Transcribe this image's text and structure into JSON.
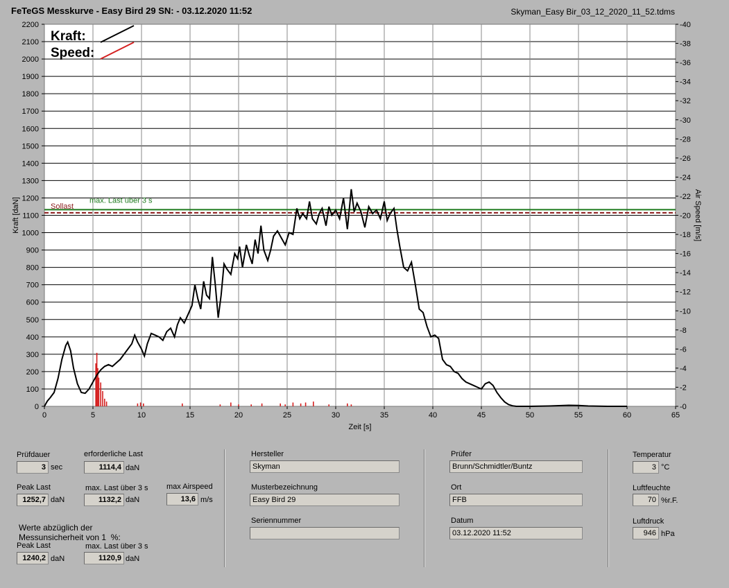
{
  "header": {
    "title": "FeTeGS Messkurve - Easy Bird 29  SN:  - 03.12.2020 11:52",
    "filename": "Skyman_Easy Bir_03_12_2020_11_52.tdms"
  },
  "chart_data": {
    "type": "line",
    "xlabel": "Zeit [s]",
    "ylabel": "Kraft [daN]",
    "y2label": "Air Speed [m/s]",
    "xlim": [
      0,
      65
    ],
    "ylim": [
      0,
      2200
    ],
    "y2lim": [
      0,
      40
    ],
    "xticks": [
      0,
      5,
      10,
      15,
      20,
      25,
      30,
      35,
      40,
      45,
      50,
      55,
      60,
      65
    ],
    "yticks": [
      0,
      100,
      200,
      300,
      400,
      500,
      600,
      700,
      800,
      900,
      1000,
      1100,
      1200,
      1300,
      1400,
      1500,
      1600,
      1700,
      1800,
      1900,
      2000,
      2100,
      2200
    ],
    "y2ticks": [
      0,
      2,
      4,
      6,
      8,
      10,
      12,
      14,
      16,
      18,
      20,
      22,
      24,
      26,
      28,
      30,
      32,
      34,
      36,
      38,
      40
    ],
    "grid": true,
    "legend": [
      {
        "label": "Kraft:",
        "color": "#000000"
      },
      {
        "label": "Speed:",
        "color": "#d42020"
      }
    ],
    "reference_lines": [
      {
        "label": "Sollast",
        "value": 1114.4,
        "color": "#8b1a1a"
      },
      {
        "label": "max. Last über  3 s",
        "value": 1132.2,
        "color": "#1e7a1e"
      }
    ],
    "series": [
      {
        "name": "Kraft",
        "color": "#000000",
        "points": [
          [
            0,
            0
          ],
          [
            0.3,
            30
          ],
          [
            0.6,
            50
          ],
          [
            1.0,
            80
          ],
          [
            1.4,
            160
          ],
          [
            1.8,
            270
          ],
          [
            2.2,
            350
          ],
          [
            2.4,
            370
          ],
          [
            2.7,
            320
          ],
          [
            3.0,
            220
          ],
          [
            3.4,
            130
          ],
          [
            3.8,
            80
          ],
          [
            4.2,
            75
          ],
          [
            4.6,
            100
          ],
          [
            5.0,
            140
          ],
          [
            5.4,
            180
          ],
          [
            5.8,
            210
          ],
          [
            6.2,
            230
          ],
          [
            6.6,
            240
          ],
          [
            7.0,
            230
          ],
          [
            7.4,
            250
          ],
          [
            7.8,
            270
          ],
          [
            8.2,
            300
          ],
          [
            8.6,
            330
          ],
          [
            9.0,
            360
          ],
          [
            9.3,
            410
          ],
          [
            9.6,
            370
          ],
          [
            10.0,
            330
          ],
          [
            10.3,
            290
          ],
          [
            10.6,
            360
          ],
          [
            11.0,
            420
          ],
          [
            11.4,
            410
          ],
          [
            11.8,
            400
          ],
          [
            12.2,
            380
          ],
          [
            12.6,
            430
          ],
          [
            13.0,
            450
          ],
          [
            13.4,
            400
          ],
          [
            13.7,
            470
          ],
          [
            14.0,
            510
          ],
          [
            14.4,
            480
          ],
          [
            14.8,
            530
          ],
          [
            15.2,
            580
          ],
          [
            15.5,
            700
          ],
          [
            15.8,
            620
          ],
          [
            16.1,
            560
          ],
          [
            16.4,
            720
          ],
          [
            16.7,
            640
          ],
          [
            17.0,
            620
          ],
          [
            17.3,
            860
          ],
          [
            17.6,
            700
          ],
          [
            17.9,
            510
          ],
          [
            18.2,
            640
          ],
          [
            18.5,
            820
          ],
          [
            18.8,
            790
          ],
          [
            19.2,
            760
          ],
          [
            19.6,
            880
          ],
          [
            19.9,
            850
          ],
          [
            20.1,
            920
          ],
          [
            20.4,
            800
          ],
          [
            20.8,
            930
          ],
          [
            21.1,
            870
          ],
          [
            21.4,
            820
          ],
          [
            21.7,
            960
          ],
          [
            22.0,
            880
          ],
          [
            22.3,
            1040
          ],
          [
            22.6,
            900
          ],
          [
            23.0,
            840
          ],
          [
            23.3,
            900
          ],
          [
            23.6,
            980
          ],
          [
            24.0,
            1010
          ],
          [
            24.4,
            970
          ],
          [
            24.8,
            930
          ],
          [
            25.2,
            1000
          ],
          [
            25.6,
            990
          ],
          [
            26.0,
            1140
          ],
          [
            26.3,
            1080
          ],
          [
            26.6,
            1110
          ],
          [
            27.0,
            1080
          ],
          [
            27.3,
            1180
          ],
          [
            27.6,
            1080
          ],
          [
            28.0,
            1050
          ],
          [
            28.3,
            1110
          ],
          [
            28.6,
            1140
          ],
          [
            29.0,
            1040
          ],
          [
            29.3,
            1150
          ],
          [
            29.6,
            1100
          ],
          [
            30.0,
            1130
          ],
          [
            30.4,
            1080
          ],
          [
            30.8,
            1200
          ],
          [
            31.2,
            1020
          ],
          [
            31.6,
            1250
          ],
          [
            31.9,
            1120
          ],
          [
            32.2,
            1170
          ],
          [
            32.6,
            1120
          ],
          [
            33.0,
            1030
          ],
          [
            33.4,
            1150
          ],
          [
            33.8,
            1110
          ],
          [
            34.2,
            1130
          ],
          [
            34.6,
            1080
          ],
          [
            35.0,
            1180
          ],
          [
            35.3,
            1070
          ],
          [
            35.6,
            1110
          ],
          [
            36.0,
            1140
          ],
          [
            36.3,
            1020
          ],
          [
            36.6,
            920
          ],
          [
            37.0,
            800
          ],
          [
            37.4,
            780
          ],
          [
            37.8,
            830
          ],
          [
            38.2,
            700
          ],
          [
            38.6,
            560
          ],
          [
            39.0,
            540
          ],
          [
            39.4,
            460
          ],
          [
            39.8,
            400
          ],
          [
            40.2,
            410
          ],
          [
            40.6,
            390
          ],
          [
            41.0,
            270
          ],
          [
            41.4,
            240
          ],
          [
            41.8,
            230
          ],
          [
            42.2,
            200
          ],
          [
            42.6,
            190
          ],
          [
            43.0,
            160
          ],
          [
            43.4,
            140
          ],
          [
            43.8,
            130
          ],
          [
            44.2,
            120
          ],
          [
            44.6,
            110
          ],
          [
            45.0,
            100
          ],
          [
            45.4,
            130
          ],
          [
            45.8,
            140
          ],
          [
            46.2,
            120
          ],
          [
            46.6,
            80
          ],
          [
            47.0,
            50
          ],
          [
            47.4,
            25
          ],
          [
            47.8,
            10
          ],
          [
            48.2,
            3
          ],
          [
            48.6,
            0
          ],
          [
            50,
            0
          ],
          [
            52,
            2
          ],
          [
            54,
            6
          ],
          [
            55,
            5
          ],
          [
            56,
            2
          ],
          [
            58,
            0
          ],
          [
            60,
            0
          ]
        ]
      },
      {
        "name": "Speed",
        "color": "#d42020",
        "bars": [
          [
            5.3,
            4.5
          ],
          [
            5.4,
            5.6
          ],
          [
            5.5,
            4.0
          ],
          [
            5.6,
            3.0
          ],
          [
            5.8,
            2.5
          ],
          [
            6.0,
            1.6
          ],
          [
            6.2,
            0.8
          ],
          [
            6.4,
            0.5
          ],
          [
            9.6,
            0.3
          ],
          [
            9.9,
            0.4
          ],
          [
            10.2,
            0.3
          ],
          [
            14.2,
            0.3
          ],
          [
            18.1,
            0.2
          ],
          [
            19.2,
            0.4
          ],
          [
            20.0,
            0.2
          ],
          [
            21.3,
            0.2
          ],
          [
            22.4,
            0.3
          ],
          [
            24.3,
            0.3
          ],
          [
            24.8,
            0.2
          ],
          [
            25.6,
            0.4
          ],
          [
            26.4,
            0.3
          ],
          [
            26.9,
            0.4
          ],
          [
            27.7,
            0.5
          ],
          [
            29.3,
            0.2
          ],
          [
            31.2,
            0.3
          ],
          [
            31.6,
            0.2
          ]
        ]
      }
    ]
  },
  "footer": {
    "pruefdauer": {
      "label": "Prüfdauer",
      "value": "3",
      "unit": "sec"
    },
    "erforderliche_last": {
      "label": "erforderliche Last",
      "value": "1114,4",
      "unit": "daN"
    },
    "peak_last": {
      "label": "Peak Last",
      "value": "1252,7",
      "unit": "daN"
    },
    "max_last": {
      "label": "max. Last über  3 s",
      "value": "1132,2",
      "unit": "daN"
    },
    "max_airspeed": {
      "label": "max Airspeed",
      "value": "13,6",
      "unit": "m/s"
    },
    "note": "Werte abzüglich der\nMessunsicherheit von 1  %:",
    "peak_last2": {
      "label": "Peak Last",
      "value": "1240,2",
      "unit": "daN"
    },
    "max_last2": {
      "label": "max. Last über  3 s",
      "value": "1120,9",
      "unit": "daN"
    },
    "hersteller": {
      "label": "Hersteller",
      "value": "Skyman"
    },
    "muster": {
      "label": "Musterbezeichnung",
      "value": "Easy Bird 29"
    },
    "serie": {
      "label": "Seriennummer",
      "value": ""
    },
    "pruefer": {
      "label": "Prüfer",
      "value": "Brunn/Schmidtler/Buntz"
    },
    "ort": {
      "label": "Ort",
      "value": "FFB"
    },
    "datum": {
      "label": "Datum",
      "value": "03.12.2020 11:52"
    },
    "temperatur": {
      "label": "Temperatur",
      "value": "3",
      "unit": "°C"
    },
    "luftfeuchte": {
      "label": "Luftfeuchte",
      "value": "70",
      "unit": "%r.F."
    },
    "luftdruck": {
      "label": "Luftdruck",
      "value": "946",
      "unit": "hPa"
    }
  }
}
